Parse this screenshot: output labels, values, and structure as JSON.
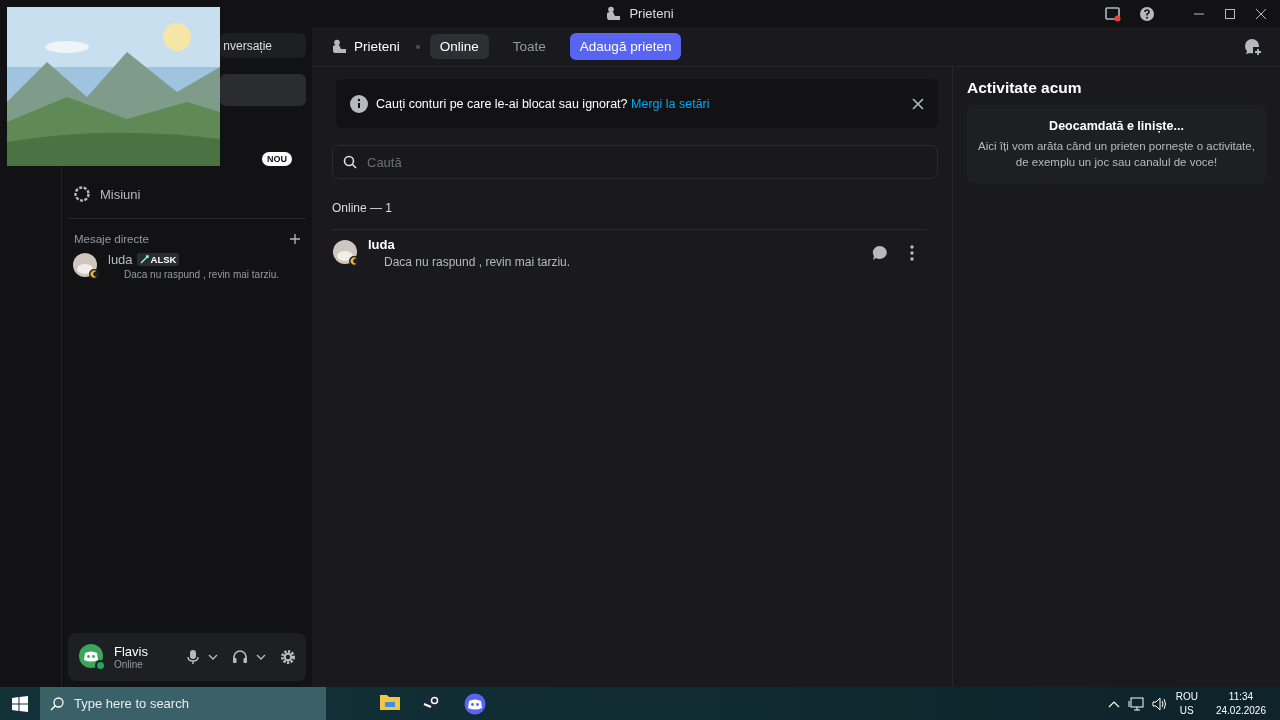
{
  "window": {
    "title": "Prieteni"
  },
  "sidebar": {
    "top_button": "nversație",
    "new_badge": "NOU",
    "items": [
      {
        "label": "Misiuni",
        "selected": false
      }
    ],
    "dm_header": "Mesaje directe",
    "direct_messages": [
      {
        "name": "luda",
        "tag": "ALSK",
        "status_text": "Daca nu raspund , revin mai tarziu."
      }
    ]
  },
  "user_panel": {
    "name": "Flavis",
    "status": "Online"
  },
  "header": {
    "title": "Prieteni",
    "tabs": [
      {
        "label": "Online",
        "selected": true
      },
      {
        "label": "Toate",
        "selected": false
      }
    ],
    "add_button": "Adaugă prieten"
  },
  "notice": {
    "text": "Cauți conturi pe care le-ai blocat sau ignorat?",
    "link": "Mergi la setări"
  },
  "search": {
    "placeholder": "Caută"
  },
  "list_header": "Online — 1",
  "friends": [
    {
      "name": "luda",
      "status_text": "Daca nu raspund , revin mai tarziu."
    }
  ],
  "activity": {
    "title": "Activitate acum",
    "empty_title": "Deocamdată e liniște...",
    "empty_text": "Aici îți vom arăta când un prieten pornește o activitate, de exemplu un joc sau canalul de voce!"
  },
  "taskbar": {
    "search_placeholder": "Type here to search",
    "language": "ROU",
    "layout": "US",
    "time": "11:34",
    "date": "24.02.2026"
  }
}
